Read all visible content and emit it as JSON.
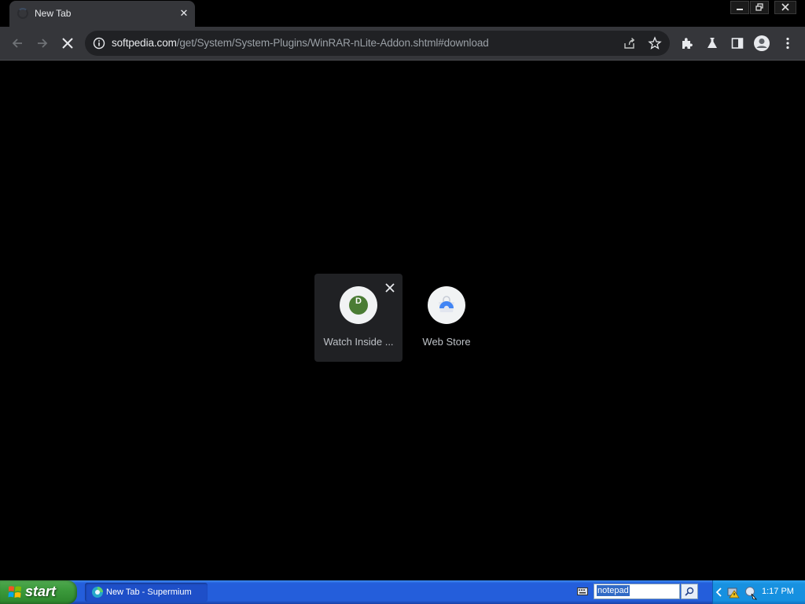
{
  "browser": {
    "tab": {
      "title": "New Tab"
    },
    "address": {
      "host": "softpedia.com",
      "path": "/get/System/System-Plugins/WinRAR-nLite-Addon.shtml#download"
    }
  },
  "shortcuts": [
    {
      "label": "Watch Inside ...",
      "icon": "letter-d-icon",
      "icon_letter": "D",
      "icon_color": "#4a7c34"
    },
    {
      "label": "Web Store",
      "icon": "web-store-icon",
      "icon_color": "#4285f4"
    }
  ],
  "taskbar": {
    "start_label": "start",
    "task": {
      "label": "New Tab - Supermium"
    },
    "search": {
      "value": "notepad"
    },
    "clock": "1:17 PM"
  },
  "colors": {
    "page_background": "#000000",
    "toolbar": "#35363a",
    "omnibox": "#202124",
    "taskbar": "#245edb",
    "start_button": "#3c9a3c"
  }
}
